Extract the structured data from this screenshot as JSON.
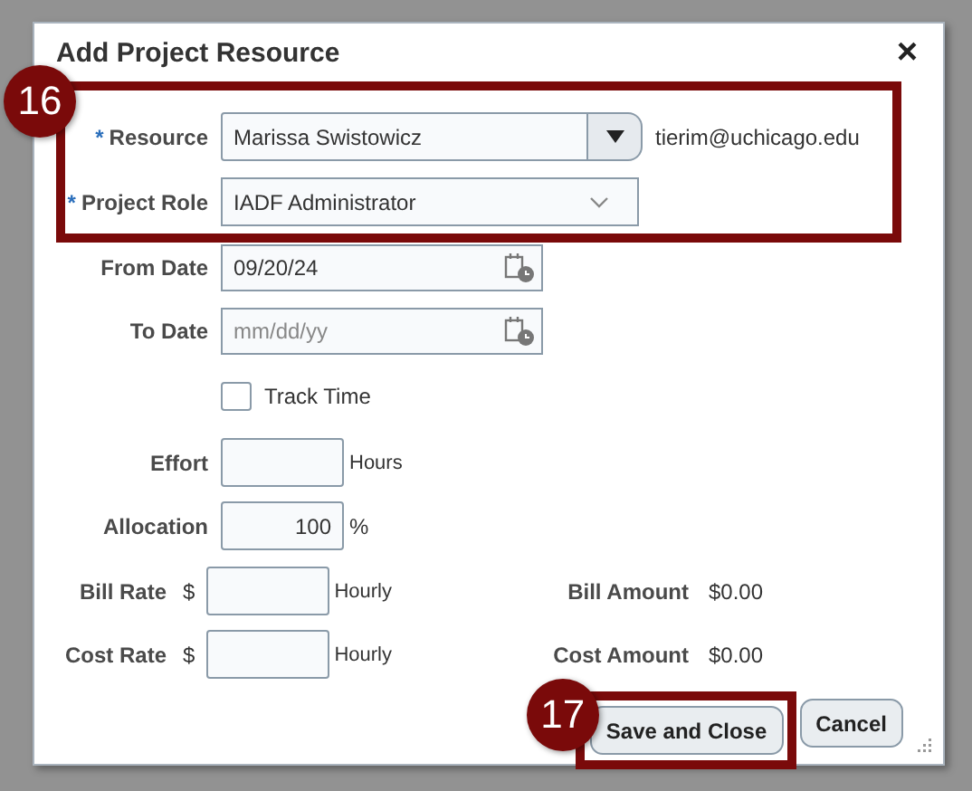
{
  "dialog": {
    "title": "Add Project Resource",
    "close": "×"
  },
  "top_group": {
    "callout": "16",
    "resource": {
      "required_mark": "*",
      "label": "Resource",
      "value": "Marissa Swistowicz",
      "email": "tierim@uchicago.edu"
    },
    "project_role": {
      "required_mark": "*",
      "label": "Project Role",
      "value": "IADF Administrator"
    }
  },
  "from_date": {
    "label": "From Date",
    "value": "09/20/24"
  },
  "to_date": {
    "label": "To Date",
    "placeholder": "mm/dd/yy"
  },
  "track_time": {
    "label": "Track Time",
    "checked": false
  },
  "effort": {
    "label": "Effort",
    "unit": "Hours"
  },
  "allocation": {
    "label": "Allocation",
    "value": "100",
    "unit": "%"
  },
  "rates": [
    {
      "label": "Bill Rate",
      "currency": "$",
      "unit": "Hourly",
      "amount_label": "Bill Amount",
      "amount": "$0.00"
    },
    {
      "label": "Cost Rate",
      "currency": "$",
      "unit": "Hourly",
      "amount_label": "Cost Amount",
      "amount": "$0.00"
    }
  ],
  "actions": {
    "callout": "17",
    "buttons": [
      {
        "label": "Save and Close",
        "highlighted": true
      },
      {
        "label": "Cancel",
        "highlighted": false
      }
    ]
  }
}
